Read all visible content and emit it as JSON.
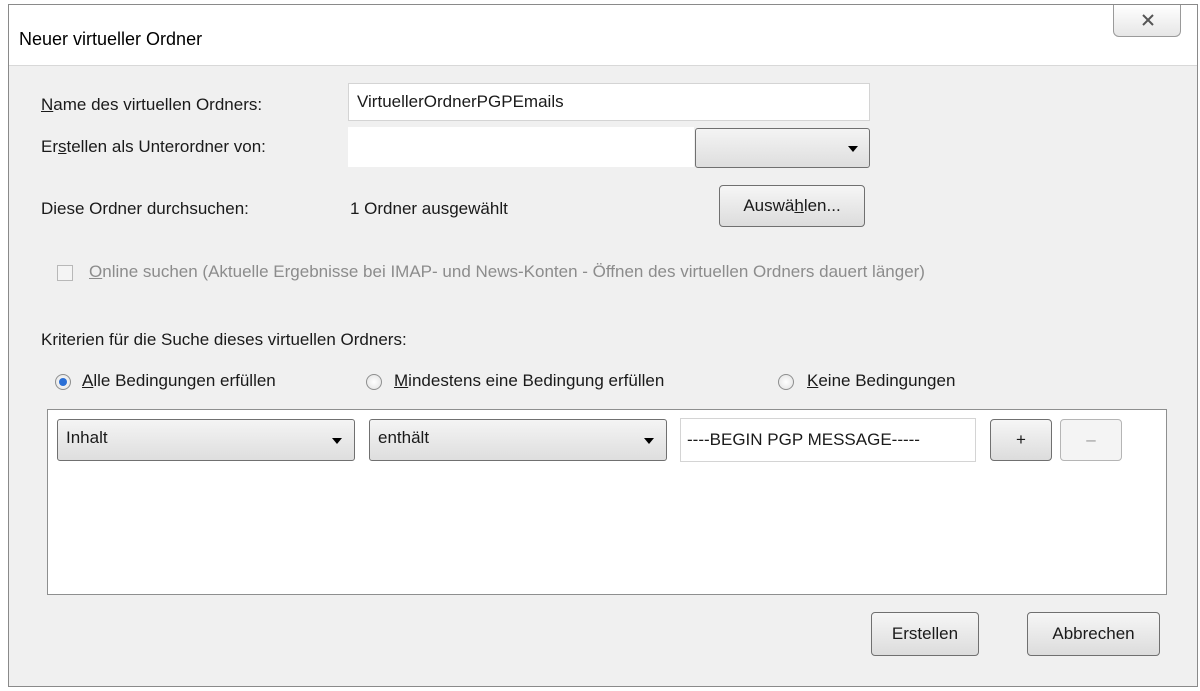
{
  "window": {
    "title": "Neuer virtueller Ordner"
  },
  "form": {
    "name_label": "Name des virtuellen Ordners:",
    "name_value": "VirtuellerOrdnerPGPEmails",
    "parent_label": "Erstellen als Unterordner von:",
    "parent_value": "",
    "search_label": "Diese Ordner durchsuchen:",
    "search_value": "1 Ordner ausgewählt",
    "select_button": "Auswählen...",
    "online_checkbox_label": "Online suchen (Aktuelle Ergebnisse bei IMAP- und News-Konten - Öffnen des virtuellen Ordners dauert länger)",
    "online_checked": false
  },
  "criteria": {
    "heading": "Kriterien für die Suche dieses virtuellen Ordners:",
    "options": [
      "Alle Bedingungen erfüllen",
      "Mindestens eine Bedingung erfüllen",
      "Keine Bedingungen"
    ],
    "selected": 0,
    "rule": {
      "field": "Inhalt",
      "operator": "enthält",
      "value": "----BEGIN PGP MESSAGE-----",
      "add_label": "+",
      "remove_label": "–"
    }
  },
  "buttons": {
    "create": "Erstellen",
    "cancel": "Abbrechen"
  },
  "colors": {
    "radio_selected": "#2a6fd6",
    "window_bg": "#f0f0f0"
  }
}
